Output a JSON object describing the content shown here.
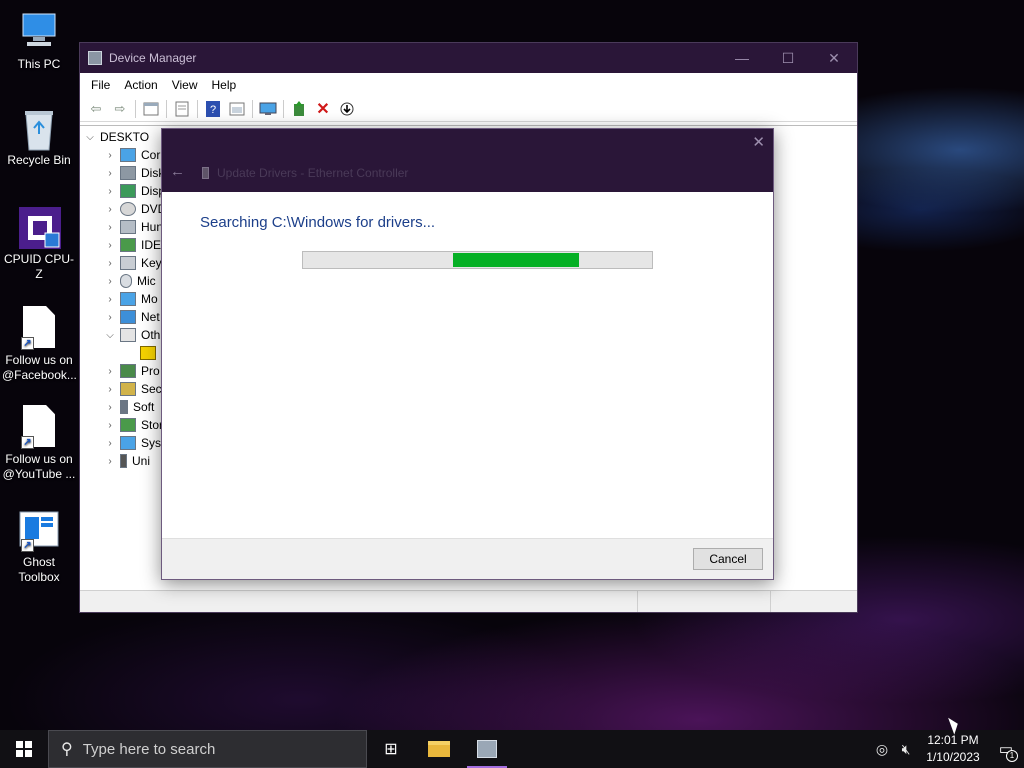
{
  "desktop": {
    "icons": [
      {
        "label": "This PC"
      },
      {
        "label": "Recycle Bin"
      },
      {
        "label": "CPUID CPU-Z"
      },
      {
        "label": "Follow us on @Facebook..."
      },
      {
        "label": "Follow us on @YouTube ..."
      },
      {
        "label": "Ghost Toolbox"
      }
    ]
  },
  "device_manager": {
    "title": "Device Manager",
    "menu": [
      "File",
      "Action",
      "View",
      "Help"
    ],
    "computer_node": "DESKTO",
    "tree_items": [
      "Cor",
      "Disk",
      "Disp",
      "DVD",
      "Hun",
      "IDE",
      "Key",
      "Mic",
      "Mo",
      "Net",
      "Oth",
      "Pro",
      "Sec",
      "Soft",
      "Stor",
      "Syst",
      "Uni"
    ]
  },
  "update_dialog": {
    "header_title": "Update Drivers - Ethernet Controller",
    "status_text": "Searching C:\\Windows for drivers...",
    "progress": {
      "fill_start_fraction": 0.43,
      "fill_end_fraction": 0.79,
      "color": "#06b025"
    },
    "cancel_label": "Cancel"
  },
  "taskbar": {
    "search_placeholder": "Type here to search",
    "time": "12:01 PM",
    "date": "1/10/2023",
    "notification_count": "1"
  },
  "colors": {
    "titlebar": "#2a1638",
    "taskbar": "#111014"
  }
}
